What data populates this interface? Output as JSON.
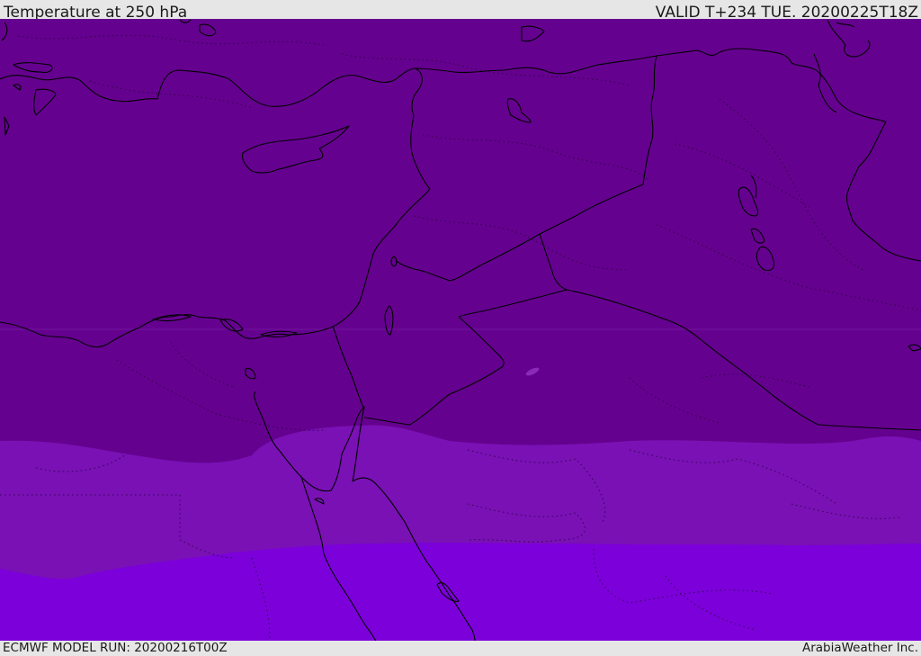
{
  "header": {
    "title": "Temperature at 250 hPa",
    "valid_time": "VALID T+234 TUE. 20200225T18Z"
  },
  "footer": {
    "model_run": "ECMWF MODEL RUN: 20200216T00Z",
    "credit": "ArabiaWeather Inc."
  },
  "map": {
    "field": "temperature",
    "level": "250 hPa",
    "colors": {
      "band_coldest": "#65018f",
      "band_middle": "#7911b4",
      "band_warmest": "#7c00da",
      "coastline": "#000000"
    }
  }
}
